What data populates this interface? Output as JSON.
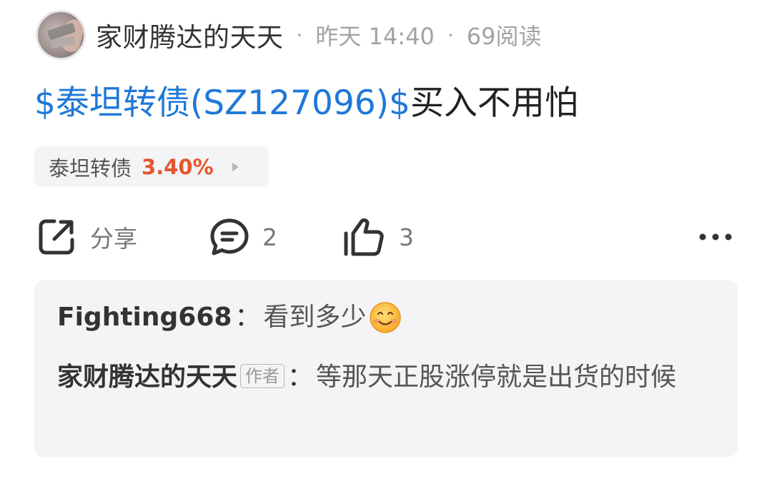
{
  "post": {
    "author": "家财腾达的天天",
    "time": "昨天 14:40",
    "separator": "·",
    "reads": "69阅读",
    "title_stock": "$泰坦转债(SZ127096)$",
    "title_text": "买入不用怕"
  },
  "stock_chip": {
    "name": "泰坦转债",
    "change": "3.40%",
    "change_color": "#e4572e"
  },
  "actions": {
    "share_label": "分享",
    "comment_count": "2",
    "like_count": "3"
  },
  "comments": [
    {
      "user": "Fighting668",
      "colon": "：",
      "text": "看到多少",
      "emoji": "smiling-face-emoji"
    },
    {
      "user": "家财腾达的天天",
      "badge": "作者",
      "colon": "：",
      "text": "等那天正股涨停就是出货的时候"
    }
  ],
  "colors": {
    "link_blue": "#1e78d8",
    "panel_bg": "#f4f4f6"
  },
  "icons": [
    "share-icon",
    "comment-icon",
    "thumbs-up-icon",
    "more-icon",
    "chevron-right-icon"
  ]
}
